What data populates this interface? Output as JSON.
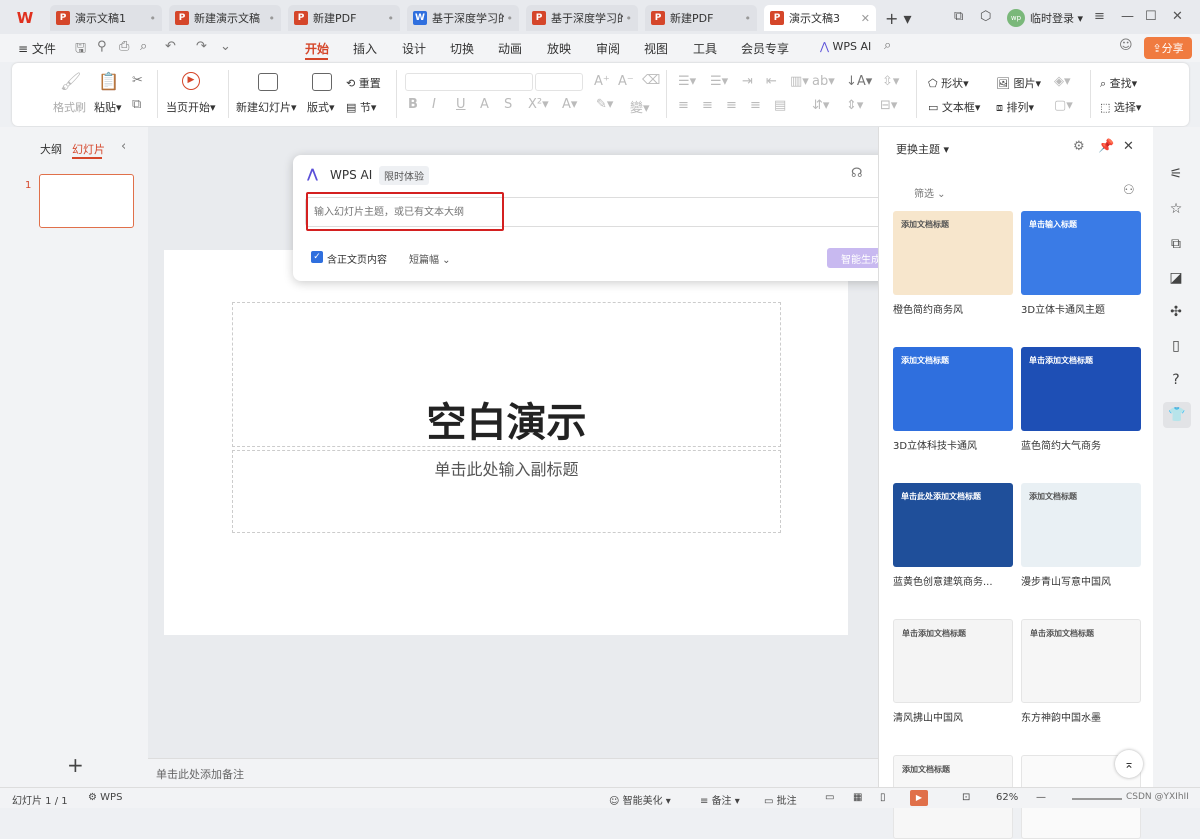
{
  "tabs": [
    {
      "label": "演示文稿1",
      "icon": "P",
      "color": "#d5462a"
    },
    {
      "label": "新建演示文稿",
      "icon": "P",
      "color": "#d5462a"
    },
    {
      "label": "新建PDF",
      "icon": "P",
      "color": "#d5462a"
    },
    {
      "label": "基于深度学习的",
      "icon": "W",
      "color": "#2f6fde"
    },
    {
      "label": "基于深度学习的逻",
      "icon": "P",
      "color": "#d5462a"
    },
    {
      "label": "新建PDF",
      "icon": "P",
      "color": "#d5462a"
    },
    {
      "label": "演示文稿3",
      "icon": "P",
      "color": "#d5462a"
    }
  ],
  "header": {
    "login": "临时登录",
    "share": "分享",
    "file": "文件"
  },
  "menu": [
    "开始",
    "插入",
    "设计",
    "切换",
    "动画",
    "放映",
    "审阅",
    "视图",
    "工具",
    "会员专享"
  ],
  "wpsai_menu": "WPS AI",
  "ribbon": {
    "format_painter": "格式刷",
    "paste": "粘贴",
    "start_current": "当页开始",
    "new_slide": "新建幻灯片",
    "layout": "版式",
    "reset": "重置",
    "section": "节",
    "shape": "形状",
    "picture": "图片",
    "textbox": "文本框",
    "arrange": "排列",
    "find": "查找",
    "select": "选择"
  },
  "left": {
    "outline": "大纲",
    "slides": "幻灯片",
    "slide_num": "1"
  },
  "slide": {
    "title": "空白演示",
    "subtitle": "单击此处输入副标题"
  },
  "notes": "单击此处添加备注",
  "ai": {
    "name": "WPS AI",
    "badge": "限时体验",
    "placeholder": "输入幻灯片主题，或已有文本大纲",
    "include_text": "含正文页内容",
    "length": "短篇幅",
    "generate": "智能生成"
  },
  "theme_panel": {
    "title": "更换主题",
    "filter": "筛选",
    "themes": [
      {
        "label": "橙色简约商务风",
        "bg": "#f7e6cc",
        "thumb_text": "添加文档标题"
      },
      {
        "label": "3D立体卡通风主题",
        "bg": "#3a7be6",
        "thumb_text": "单击输入标题"
      },
      {
        "label": "3D立体科技卡通风",
        "bg": "#2f6fde",
        "thumb_text": "添加文档标题"
      },
      {
        "label": "蓝色简约大气商务",
        "bg": "#1e4fb5",
        "thumb_text": "单击添加文档标题"
      },
      {
        "label": "蓝黄色创意建筑商务...",
        "bg": "#1f4f9a",
        "thumb_text": "单击此处添加文档标题"
      },
      {
        "label": "漫步青山写意中国风",
        "bg": "#e9f0f4",
        "thumb_text": "添加文档标题"
      },
      {
        "label": "清风拂山中国风",
        "bg": "#f4f4f4",
        "thumb_text": "单击添加文档标题"
      },
      {
        "label": "东方神韵中国水墨",
        "bg": "#f6f6f6",
        "thumb_text": "单击添加文档标题"
      },
      {
        "label": "",
        "bg": "#f7f7f7",
        "thumb_text": "添加文档标题"
      },
      {
        "label": "",
        "bg": "#fafafa",
        "thumb_text": ""
      }
    ]
  },
  "status": {
    "slide_info": "幻灯片 1 / 1",
    "wps": "WPS",
    "beautify": "智能美化",
    "notes": "备注",
    "comment": "批注",
    "zoom": "62%",
    "watermark": "CSDN @YXIhII"
  }
}
